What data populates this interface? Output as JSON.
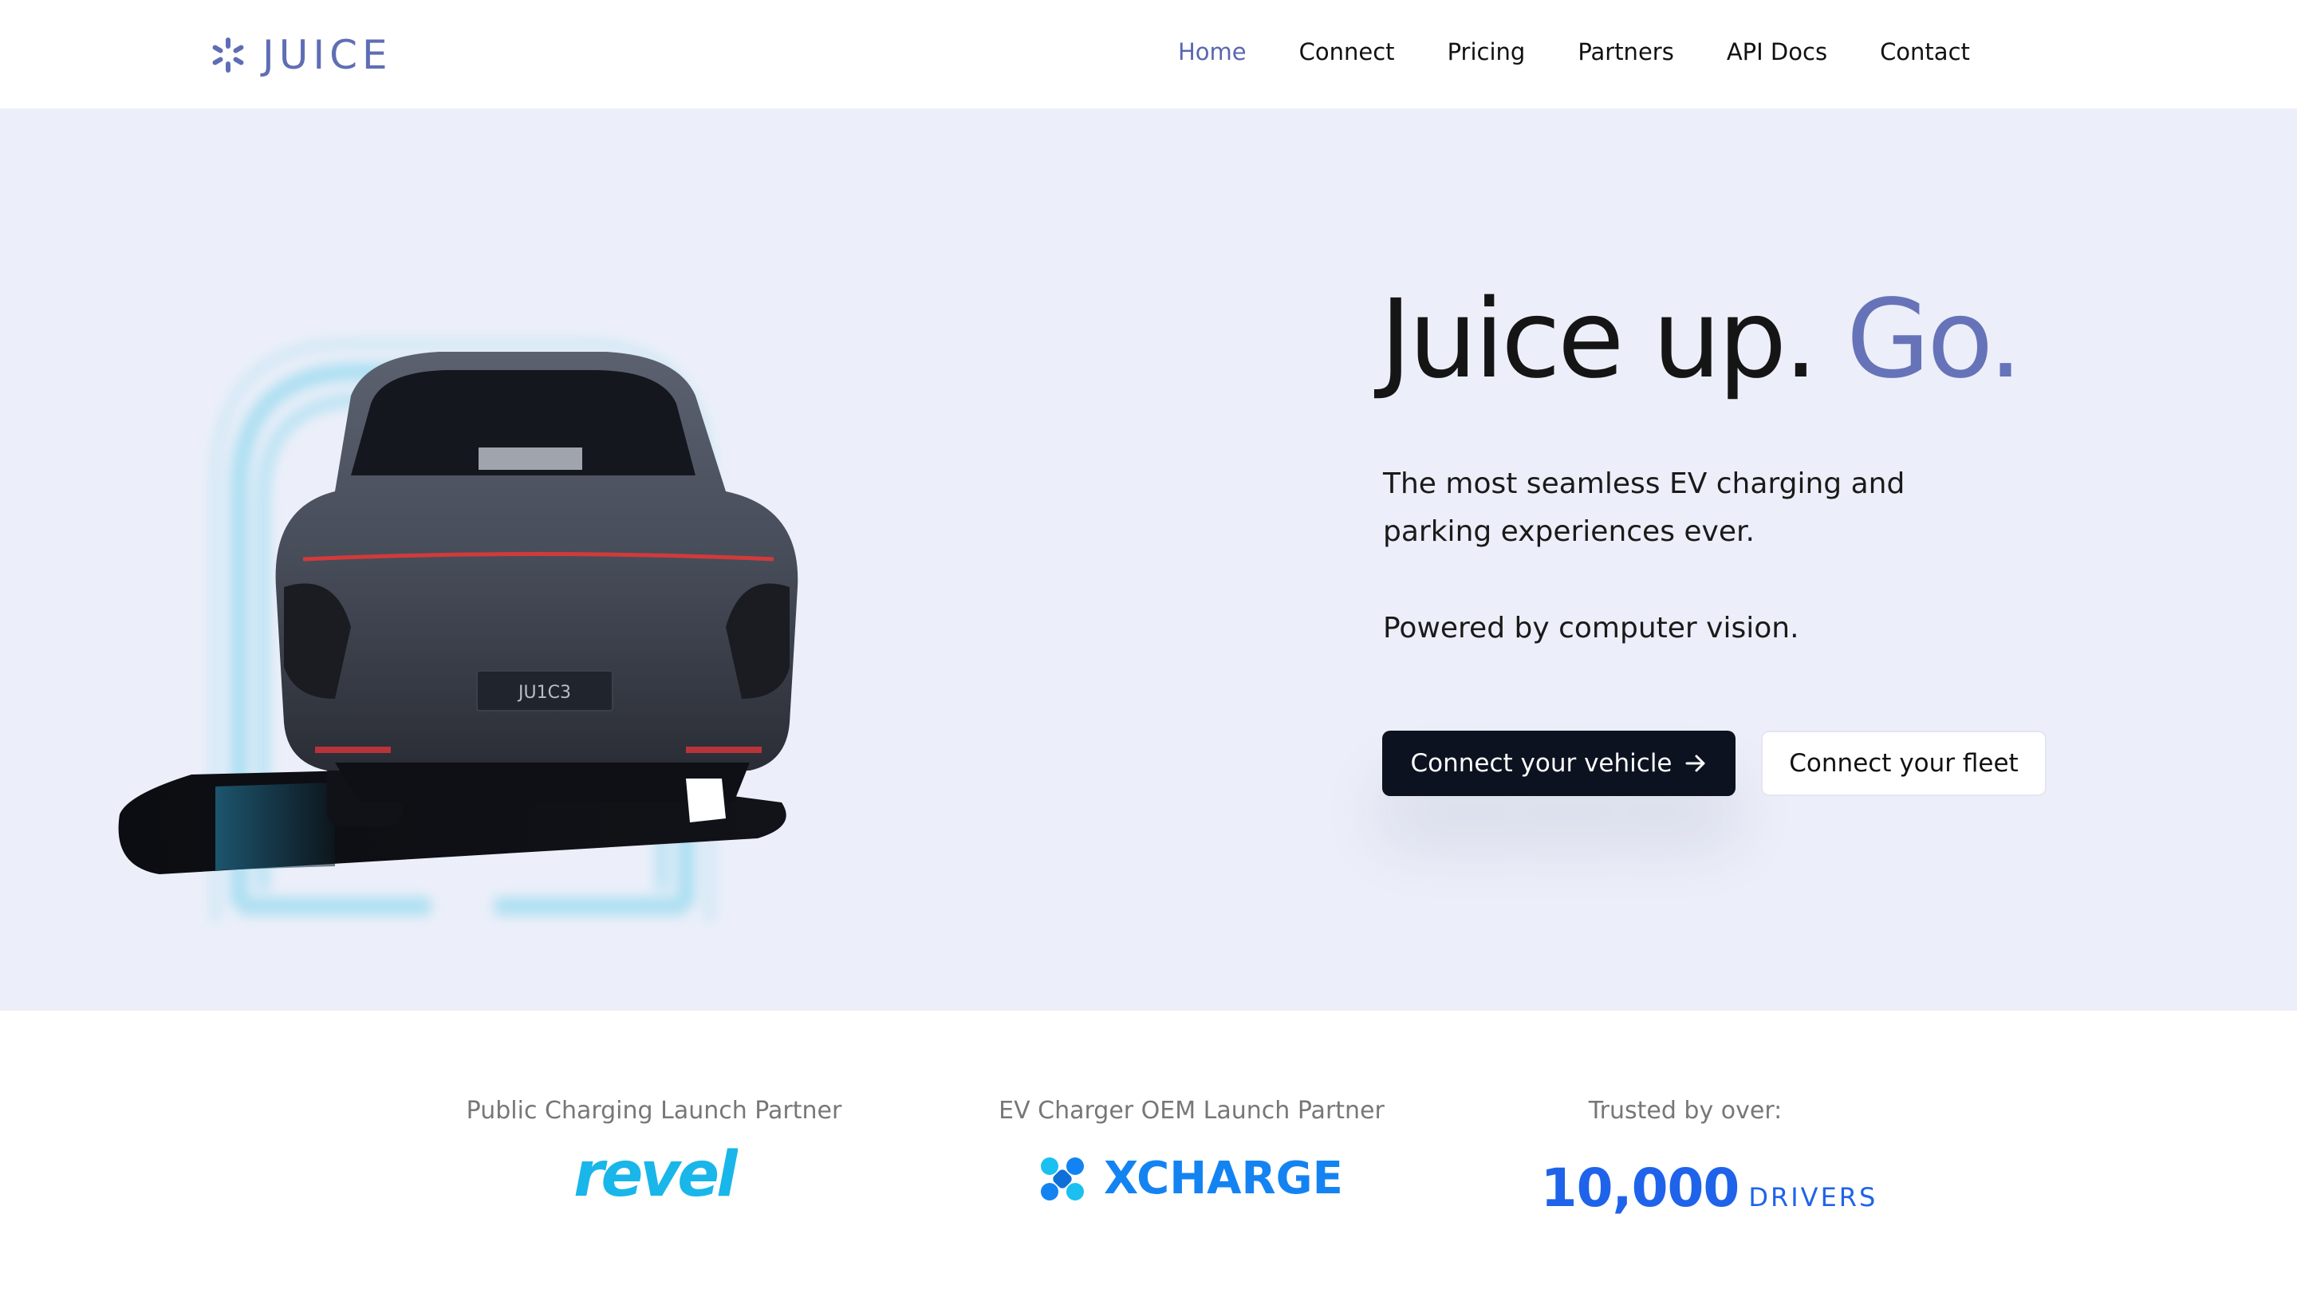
{
  "nav": {
    "logo_text": "JUICE",
    "links": [
      {
        "label": "Home",
        "active": true
      },
      {
        "label": "Connect",
        "active": false
      },
      {
        "label": "Pricing",
        "active": false
      },
      {
        "label": "Partners",
        "active": false
      },
      {
        "label": "API Docs",
        "active": false
      },
      {
        "label": "Contact",
        "active": false
      }
    ]
  },
  "hero": {
    "title_main": "Juice up. ",
    "title_accent": "Go.",
    "subtitle_line1": "The most seamless EV charging and",
    "subtitle_line2": "parking experiences ever.",
    "subtitle2": "Powered by computer vision.",
    "primary_button": "Connect your vehicle",
    "secondary_button": "Connect your fleet",
    "license_plate": "JU1C3"
  },
  "partners": {
    "public_label": "Public Charging Launch Partner",
    "public_logo": "revel",
    "oem_label": "EV Charger OEM Launch Partner",
    "oem_logo": "XCHARGE",
    "trusted_label": "Trusted by over:",
    "trusted_number": "10,000",
    "trusted_unit": "DRIVERS"
  },
  "colors": {
    "accent": "#6773b8",
    "hero_bg": "#eceff9",
    "primary_button": "#0c1220",
    "revel": "#19b6ea",
    "xcharge": "#1483f2",
    "drivers": "#1f63ea"
  }
}
